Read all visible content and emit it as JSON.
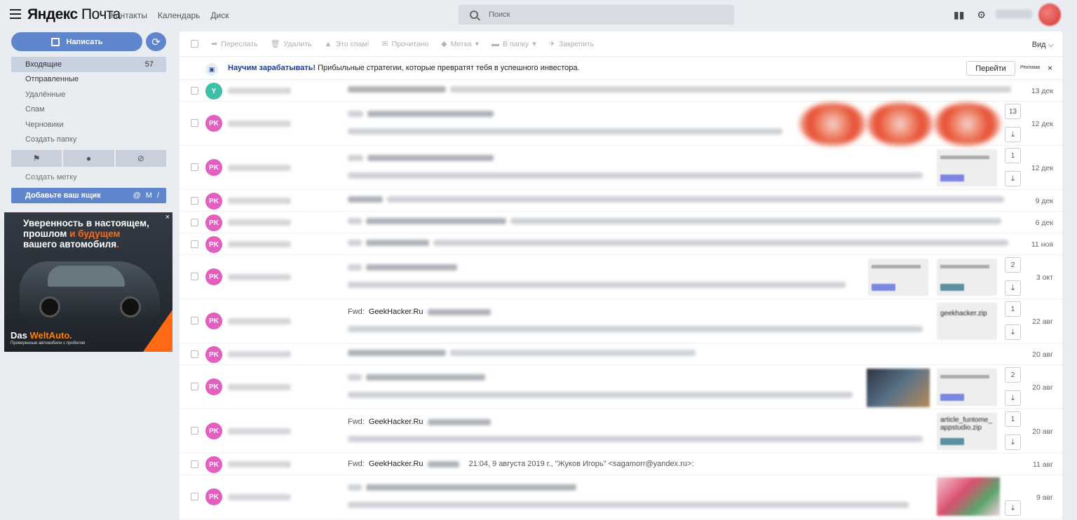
{
  "header": {
    "logo_bold": "Яндекс",
    "logo_rest": "Почта",
    "nav": [
      "Контакты",
      "Календарь",
      "Диск"
    ],
    "search_placeholder": "Поиск"
  },
  "sidebar": {
    "compose_label": "Написать",
    "folders": [
      {
        "label": "Входящие",
        "count": "57"
      },
      {
        "label": "Отправленные",
        "count": ""
      },
      {
        "label": "Удалённые",
        "count": ""
      },
      {
        "label": "Спам",
        "count": ""
      },
      {
        "label": "Черновики",
        "count": ""
      },
      {
        "label": "Создать папку",
        "count": ""
      }
    ],
    "create_tag": "Создать метку",
    "add_mailbox": "Добавьте ваш ящик",
    "add_mailbox_icons": [
      "@",
      "M",
      "/"
    ]
  },
  "ad": {
    "line1": "Уверенность в настоящем,",
    "line2a": "прошлом ",
    "line2b": "и будущем",
    "line3": "вашего автомобиля",
    "line3_dot": ".",
    "brand_a": "Das ",
    "brand_b": "WeltAuto.",
    "tagline": "Проверенные автомобили с пробегом",
    "plate": "DasWeltAuto",
    "close": "×"
  },
  "toolbar": {
    "forward": "Переслать",
    "delete": "Удалить",
    "spam": "Это спам!",
    "read": "Прочитано",
    "label": "Метка",
    "folder": "В папку",
    "pin": "Закрепить",
    "view": "Вид"
  },
  "promo": {
    "bold": "Научим зарабатывать!",
    "text": " Прибыльные стратегии, которые превратят тебя в успешного инвестора.",
    "button": "Перейти",
    "ad_label": "Реклама",
    "close": "×"
  },
  "emails": [
    {
      "avatar": "Y",
      "date": "13 дек"
    },
    {
      "avatar": "PK",
      "date": "12 дек",
      "count": "13"
    },
    {
      "avatar": "PK",
      "date": "12 дек",
      "count": "1"
    },
    {
      "avatar": "PK",
      "date": "9 дек"
    },
    {
      "avatar": "PK",
      "date": "6 дек"
    },
    {
      "avatar": "PK",
      "date": "11 ноя"
    },
    {
      "avatar": "PK",
      "date": "3 окт",
      "count": "2"
    },
    {
      "avatar": "PK",
      "date": "22 авг",
      "count": "1",
      "prefix": "Fwd:",
      "subject": "GeekHacker.Ru",
      "attachment": "geekhacker.zip"
    },
    {
      "avatar": "PK",
      "date": "20 авг"
    },
    {
      "avatar": "PK",
      "date": "20 авг",
      "count": "2"
    },
    {
      "avatar": "PK",
      "date": "20 авг",
      "count": "1",
      "prefix": "Fwd:",
      "subject": "GeekHacker.Ru",
      "attachment": "article_funtome_\nappstudio.zip"
    },
    {
      "avatar": "PK",
      "date": "11 авг",
      "prefix": "Fwd:",
      "subject": "GeekHacker.Ru",
      "snippet": "21:04, 9 августа 2019 г., \"Жуков Игорь\" <sagamorr@yandex.ru>:"
    },
    {
      "avatar": "PK",
      "date": "9 авг"
    }
  ]
}
